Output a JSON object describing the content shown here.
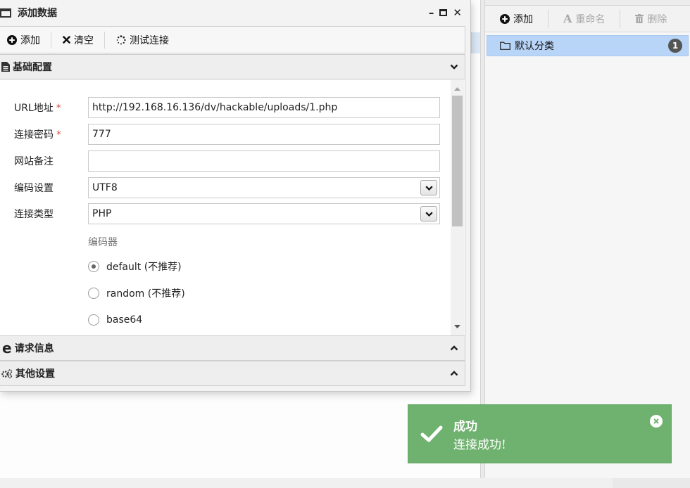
{
  "dialog": {
    "title": "添加数据",
    "controls": {
      "minimize": "–",
      "close": "✕"
    },
    "toolbar": {
      "add": "添加",
      "clear": "清空",
      "test": "测试连接"
    },
    "sections": {
      "basic": "基础配置",
      "request": "请求信息",
      "other": "其他设置"
    },
    "form": {
      "url_label": "URL地址",
      "url_value": "http://192.168.16.136/dv/hackable/uploads/1.php",
      "password_label": "连接密码",
      "password_value": "777",
      "note_label": "网站备注",
      "note_value": "",
      "encoding_label": "编码设置",
      "encoding_value": "UTF8",
      "type_label": "连接类型",
      "type_value": "PHP",
      "required_mark": "*",
      "encoder_title": "编码器",
      "encoders": [
        {
          "label": "default (不推荐)",
          "checked": true
        },
        {
          "label": "random (不推荐)",
          "checked": false
        },
        {
          "label": "base64",
          "checked": false
        }
      ]
    }
  },
  "category_panel": {
    "toolbar": {
      "add": "添加",
      "rename": "重命名",
      "delete": "删除"
    },
    "items": [
      {
        "label": "默认分类",
        "count": "1"
      }
    ]
  },
  "toast": {
    "title": "成功",
    "message": "连接成功!",
    "color": "#6fb26f"
  }
}
